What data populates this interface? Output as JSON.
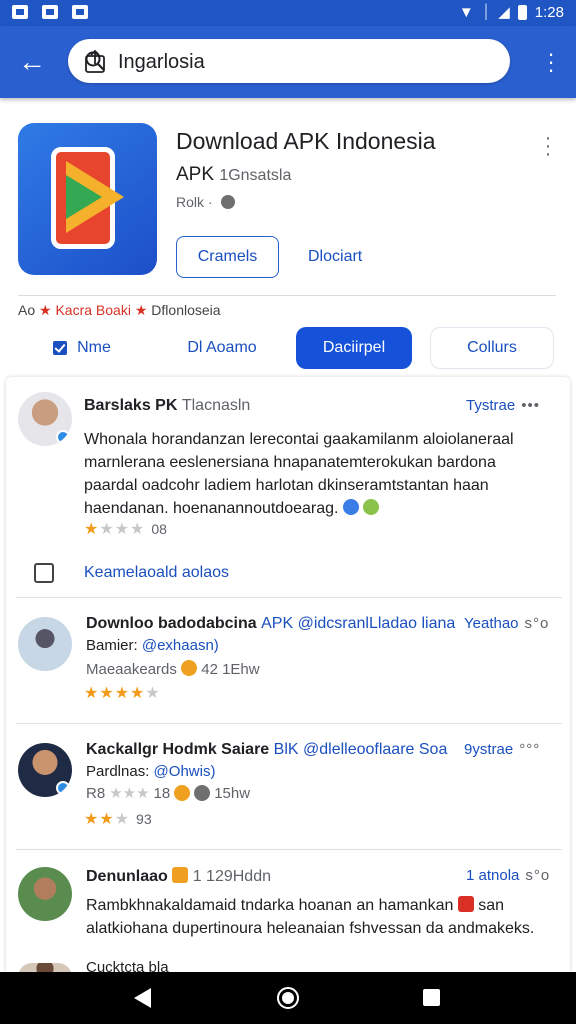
{
  "status_bar": {
    "time": "1:28"
  },
  "search": {
    "value": "Ingarlosia"
  },
  "app": {
    "title": "Download APK Indonesia",
    "subtitle": "APK",
    "subtitle_extra": "1Gnsatsla",
    "meta": "Rolk ·",
    "primary_button": "Cramels",
    "secondary_button": "Dlociart",
    "tagline_prefix": "Ao",
    "tagline_highlight": "Kacra Boaki",
    "tagline_suffix": "Dflonloseia"
  },
  "tabs": [
    {
      "label": "Nme"
    },
    {
      "label": "Dl Aoamo"
    },
    {
      "label": "Daciirpel"
    },
    {
      "label": "Collurs"
    }
  ],
  "reviews": [
    {
      "name": "Barslaks PK",
      "name_extra": "Tlacnasln",
      "right_label": "Tystrae",
      "body": "Whonala horandanzan lerecontai gaakamilanm aloiolaneraal marnlerana eeslenersiana hnapanatemterokukan bardona paardal oadcohr ladiem harlotan dkinseramtstantan haan haendanan. hoenanannoutdoearag.",
      "rating": 2,
      "count": "08",
      "footer_link": "Keamelaoald aolaos"
    },
    {
      "name": "Downloo badodabcina",
      "name_link": "APK @idcsranlLladao liana",
      "right_label": "Yeathao",
      "sub_label": "Bamier:",
      "sub_link": "@exhaasn)",
      "sub_meta_prefix": "Maeaakeards",
      "sub_meta": "42 1Ehw",
      "rating": 4
    },
    {
      "name": "Kackallgr Hodmk Saiare",
      "name_link": "BlK @dlelleooflaare Soa",
      "right_label": "9ystrae",
      "sub_label": "Pardlnas:",
      "sub_link": "@Ohwis)",
      "meta_prefix": "R8",
      "meta_count": "18",
      "meta_suffix": "15hw",
      "rating": 2,
      "count": "93"
    },
    {
      "name": "Denunlaao",
      "name_extra": "1 129Hddn",
      "right_label": "1 atnola",
      "body": "Rambkhnakaldamaid tndarka hoanan an hamankan",
      "body_tail": "san alatkiohana dupertinoura heleanaian fshvessan da andmakeks.",
      "cutoff": "Cucktcta bla"
    }
  ],
  "colors": {
    "accent": "#2a5fcf",
    "active_tab": "#1552d9",
    "star": "#f29b1b"
  }
}
